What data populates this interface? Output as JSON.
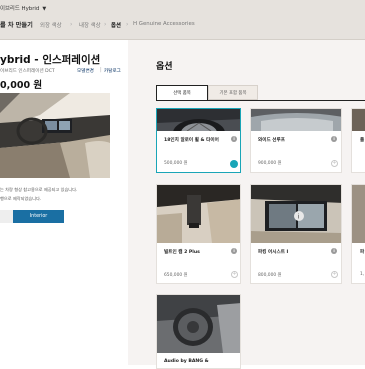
{
  "header": {
    "model_selector": "이브리드 Hybrid",
    "breadcrumb": [
      "를 차 만들기",
      "외장 색상",
      "내장 색상",
      "옵션",
      "H Genuine Accessories"
    ]
  },
  "summary": {
    "car_name": "ybrid - 인스퍼레이션",
    "trim": "이브리드 인스퍼레이션 DCT",
    "link_model_change": "모델변경",
    "link_catalog": "카탈로그",
    "price": "0,000 원",
    "notes": [
      "는 차량 형상 참고용으로 제공되고 있습니다.",
      "행으로 제작되었습니다."
    ],
    "view_buttons": {
      "interior": "Interior"
    }
  },
  "options": {
    "title": "옵션",
    "tabs": [
      "선택 품목",
      "기본 포함 품목"
    ],
    "items": [
      {
        "name": "18인치 알로이 휠 & 타이어",
        "price": "500,000 원",
        "selected": true
      },
      {
        "name": "와이드 선루프",
        "price": "900,000 원",
        "selected": false
      },
      {
        "name": "플",
        "price": "",
        "selected": false
      },
      {
        "name": "빌트인 캠 2 Plus",
        "price": "650,000 원",
        "selected": false
      },
      {
        "name": "파킹 어시스트 I",
        "price": "800,000 원",
        "selected": false
      },
      {
        "name": "파",
        "price": "1,",
        "selected": false
      },
      {
        "name": "Audio by BANG &",
        "price": "",
        "selected": false
      }
    ]
  },
  "colors": {
    "accent": "#19a5b7",
    "brand": "#002c5f",
    "button": "#1a6fa3"
  }
}
